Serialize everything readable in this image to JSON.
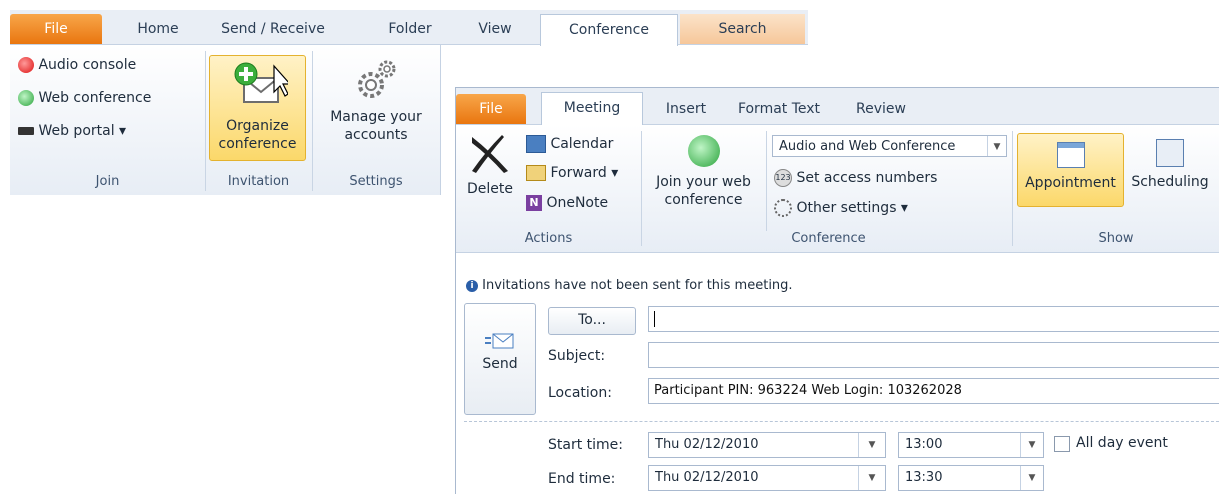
{
  "main_window": {
    "tabs": [
      "File",
      "Home",
      "Send / Receive",
      "Folder",
      "View",
      "Conference",
      "Search"
    ],
    "join_group": {
      "items": [
        {
          "label": "Audio console",
          "icon": "audio-console-icon"
        },
        {
          "label": "Web conference",
          "icon": "web-conference-icon"
        },
        {
          "label": "Web portal ▾",
          "icon": "web-portal-icon"
        }
      ],
      "label": "Join"
    },
    "invitation_group": {
      "button_line1": "Organize",
      "button_line2": "conference",
      "label": "Invitation"
    },
    "settings_group": {
      "button_line1": "Manage your",
      "button_line2": "accounts",
      "label": "Settings"
    }
  },
  "meeting_window": {
    "tabs": [
      "File",
      "Meeting",
      "Insert",
      "Format Text",
      "Review"
    ],
    "actions_group": {
      "delete_label": "Delete",
      "calendar_label": "Calendar",
      "forward_label": "Forward ▾",
      "onenote_label": "OneNote",
      "label": "Actions"
    },
    "conference_group": {
      "join_line1": "Join your web",
      "join_line2": "conference",
      "dropdown_value": "Audio and Web Conference",
      "access_numbers": "Set access numbers",
      "other_settings": "Other settings ▾",
      "label": "Conference"
    },
    "show_group": {
      "appointment": "Appointment",
      "scheduling": "Scheduling",
      "label": "Show"
    },
    "info_bar": "Invitations have not been sent for this meeting.",
    "form": {
      "send_label": "Send",
      "to_button": "To...",
      "to_value": "",
      "subject_label": "Subject:",
      "subject_value": "",
      "location_label": "Location:",
      "location_value": "Participant PIN: 963224 Web Login: 103262028",
      "start_label": "Start time:",
      "start_date": "Thu 02/12/2010",
      "start_time": "13:00",
      "all_day_label": "All day event",
      "all_day_checked": false,
      "end_label": "End time:",
      "end_date": "Thu 02/12/2010",
      "end_time": "13:30"
    }
  },
  "colors": {
    "file_tab": "#e9760f",
    "highlight": "#fbd86a",
    "ribbon_bg": "#e7edf5"
  }
}
